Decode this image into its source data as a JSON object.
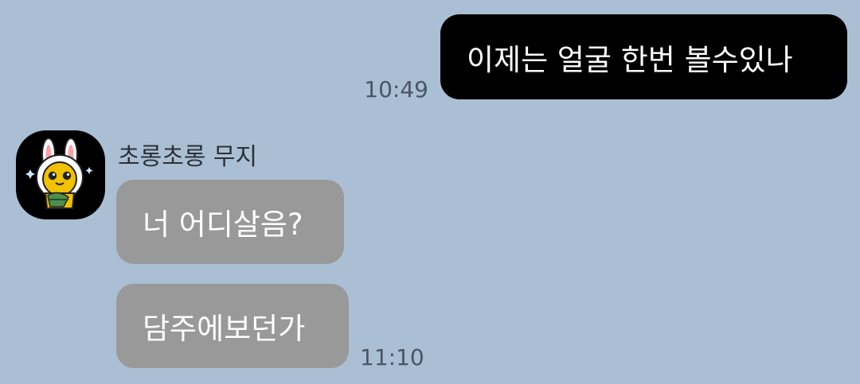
{
  "colors": {
    "chat_background": "#abbfd4",
    "outgoing_bubble": "#000000",
    "incoming_bubble": "#999999",
    "bubble_text": "#ffffff"
  },
  "messages": {
    "outgoing": {
      "text": "이제는 얼굴 한번 볼수있나",
      "time": "10:49"
    },
    "incoming": {
      "sender": "초롱초롱 무지",
      "avatar_icon": "muzi-character-avatar-icon",
      "items": [
        {
          "text": "너 어디살음?"
        },
        {
          "text": "담주에보던가"
        }
      ],
      "time": "11:10"
    }
  }
}
